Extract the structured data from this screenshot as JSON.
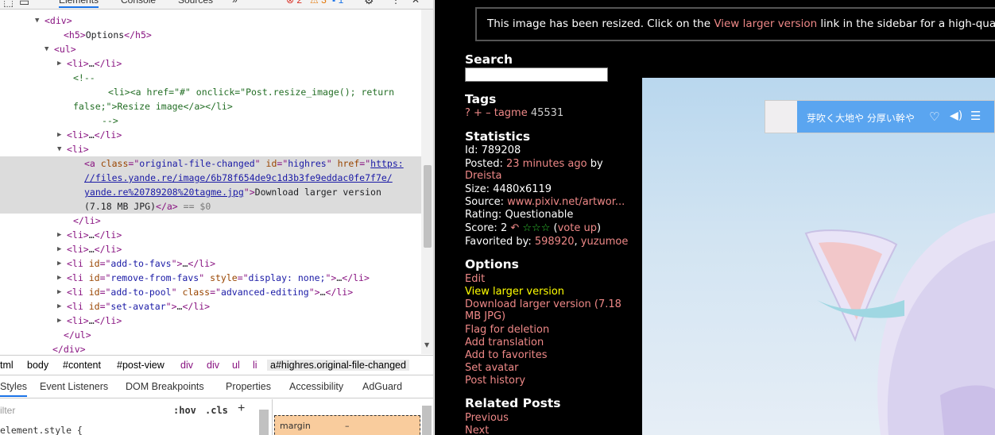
{
  "devtools": {
    "tabs": [
      "Elements",
      "Console",
      "Sources",
      "»"
    ],
    "badges": {
      "errors": "2",
      "warnings": "3",
      "info": "1"
    },
    "dom_lines": [
      {
        "indent": 56,
        "tri": "▼",
        "parts": [
          [
            "tag",
            "<div>"
          ]
        ]
      },
      {
        "indent": 80,
        "tri": "",
        "parts": [
          [
            "tag",
            "<h5>"
          ],
          [
            "txt",
            "Options"
          ],
          [
            "tag",
            "</h5>"
          ]
        ]
      },
      {
        "indent": 68,
        "tri": "▼",
        "parts": [
          [
            "tag",
            "<ul>"
          ]
        ]
      },
      {
        "indent": 84,
        "tri": "▶",
        "parts": [
          [
            "tag",
            "<li>"
          ],
          [
            "txt",
            "…"
          ],
          [
            "tag",
            "</li>"
          ]
        ]
      },
      {
        "indent": 92,
        "tri": "",
        "parts": [
          [
            "cm",
            "<!--"
          ]
        ]
      },
      {
        "indent": 136,
        "tri": "",
        "parts": [
          [
            "cm",
            "<li><a href=\"#\" onclick=\"Post.resize_image(); return"
          ]
        ]
      },
      {
        "indent": 92,
        "tri": "",
        "parts": [
          [
            "cm",
            "false;\">Resize image</a></li>"
          ]
        ]
      },
      {
        "indent": 128,
        "tri": "",
        "parts": [
          [
            "cm",
            "-->"
          ]
        ]
      },
      {
        "indent": 84,
        "tri": "▶",
        "parts": [
          [
            "tag",
            "<li>"
          ],
          [
            "txt",
            "…"
          ],
          [
            "tag",
            "</li>"
          ]
        ]
      },
      {
        "indent": 84,
        "tri": "▼",
        "parts": [
          [
            "tag",
            "<li>"
          ]
        ]
      },
      {
        "indent": 106,
        "tri": "",
        "sel": true,
        "parts": [
          [
            "tag",
            "<a "
          ],
          [
            "an",
            "class"
          ],
          [
            "tag",
            "=\""
          ],
          [
            "av",
            "original-file-changed"
          ],
          [
            "tag",
            "\" "
          ],
          [
            "an",
            "id"
          ],
          [
            "tag",
            "=\""
          ],
          [
            "av",
            "highres"
          ],
          [
            "tag",
            "\" "
          ],
          [
            "an",
            "href"
          ],
          [
            "tag",
            "=\""
          ],
          [
            "lnk",
            "https:"
          ]
        ]
      },
      {
        "indent": 106,
        "tri": "",
        "sel": true,
        "parts": [
          [
            "lnk",
            "//files.yande.re/image/6b78f654de9c1d3b3fe9eddac0fe7f7e/"
          ]
        ]
      },
      {
        "indent": 106,
        "tri": "",
        "sel": true,
        "parts": [
          [
            "lnk",
            "yande.re%20789208%20tagme.jpg"
          ],
          [
            "tag",
            "\">"
          ],
          [
            "txt",
            "Download larger version"
          ]
        ]
      },
      {
        "indent": 106,
        "tri": "",
        "sel": true,
        "parts": [
          [
            "txt",
            "(7.18 MB JPG)"
          ],
          [
            "tag",
            "</a>"
          ],
          [
            "gr",
            " == $0"
          ]
        ]
      },
      {
        "indent": 92,
        "tri": "",
        "parts": [
          [
            "tag",
            "</li>"
          ]
        ]
      },
      {
        "indent": 84,
        "tri": "▶",
        "parts": [
          [
            "tag",
            "<li>"
          ],
          [
            "txt",
            "…"
          ],
          [
            "tag",
            "</li>"
          ]
        ]
      },
      {
        "indent": 84,
        "tri": "▶",
        "parts": [
          [
            "tag",
            "<li>"
          ],
          [
            "txt",
            "…"
          ],
          [
            "tag",
            "</li>"
          ]
        ]
      },
      {
        "indent": 84,
        "tri": "▶",
        "parts": [
          [
            "tag",
            "<li "
          ],
          [
            "an",
            "id"
          ],
          [
            "tag",
            "=\""
          ],
          [
            "av",
            "add-to-favs"
          ],
          [
            "tag",
            "\">"
          ],
          [
            "txt",
            "…"
          ],
          [
            "tag",
            "</li>"
          ]
        ]
      },
      {
        "indent": 84,
        "tri": "▶",
        "parts": [
          [
            "tag",
            "<li "
          ],
          [
            "an",
            "id"
          ],
          [
            "tag",
            "=\""
          ],
          [
            "av",
            "remove-from-favs"
          ],
          [
            "tag",
            "\" "
          ],
          [
            "an",
            "style"
          ],
          [
            "tag",
            "=\""
          ],
          [
            "av",
            "display: none;"
          ],
          [
            "tag",
            "\">"
          ],
          [
            "txt",
            "…"
          ],
          [
            "tag",
            "</li>"
          ]
        ]
      },
      {
        "indent": 84,
        "tri": "▶",
        "parts": [
          [
            "tag",
            "<li "
          ],
          [
            "an",
            "id"
          ],
          [
            "tag",
            "=\""
          ],
          [
            "av",
            "add-to-pool"
          ],
          [
            "tag",
            "\" "
          ],
          [
            "an",
            "class"
          ],
          [
            "tag",
            "=\""
          ],
          [
            "av",
            "advanced-editing"
          ],
          [
            "tag",
            "\">"
          ],
          [
            "txt",
            "…"
          ],
          [
            "tag",
            "</li>"
          ]
        ]
      },
      {
        "indent": 84,
        "tri": "▶",
        "parts": [
          [
            "tag",
            "<li "
          ],
          [
            "an",
            "id"
          ],
          [
            "tag",
            "=\""
          ],
          [
            "av",
            "set-avatar"
          ],
          [
            "tag",
            "\">"
          ],
          [
            "txt",
            "…"
          ],
          [
            "tag",
            "</li>"
          ]
        ]
      },
      {
        "indent": 84,
        "tri": "▶",
        "parts": [
          [
            "tag",
            "<li>"
          ],
          [
            "txt",
            "…"
          ],
          [
            "tag",
            "</li>"
          ]
        ]
      },
      {
        "indent": 80,
        "tri": "",
        "parts": [
          [
            "tag",
            "</ul>"
          ]
        ]
      },
      {
        "indent": 66,
        "tri": "",
        "parts": [
          [
            "tag",
            "</div>"
          ]
        ]
      }
    ],
    "breadcrumbs": [
      "tml",
      "body",
      "#content",
      "#post-view",
      "div",
      "div",
      "ul",
      "li",
      "a#highres.original-file-changed"
    ],
    "sub_tabs": [
      "Styles",
      "Event Listeners",
      "DOM Breakpoints",
      "Properties",
      "Accessibility",
      "AdGuard"
    ],
    "filter_placeholder": "ilter",
    "hov_label": ":hov",
    "cls_label": ".cls",
    "plus_label": "+",
    "element_style": "element.style {",
    "box_margin_label": "margin",
    "box_margin_value": "–"
  },
  "page": {
    "notice_prefix": "This image has been resized. Click on the ",
    "notice_link": "View larger version",
    "notice_suffix": " link in the sidebar for a high-quality v",
    "search_heading": "Search",
    "tags_heading": "Tags",
    "tag_q": "?",
    "tag_plus": "+",
    "tag_minus": "–",
    "tag_name": "tagme",
    "tag_count": "45531",
    "stats_heading": "Statistics",
    "id_label": "Id:",
    "id_value": "789208",
    "posted_label": "Posted:",
    "posted_value": "23 minutes ago",
    "posted_by": " by",
    "poster": "Dreista",
    "size_label": "Size:",
    "size_value": "4480x6119",
    "source_label": "Source:",
    "source_value": "www.pixiv.net/artwor...",
    "rating_label": "Rating:",
    "rating_value": "Questionable",
    "score_label": "Score:",
    "score_value": "2",
    "score_stars": "☆☆☆",
    "vote_up": "vote up",
    "fav_label": "Favorited by:",
    "fav_user1": "598920",
    "fav_user2": "yuzumoe",
    "options_heading": "Options",
    "opt_edit": "Edit",
    "opt_view_larger": "View larger version",
    "opt_download_1": "Download larger version (7.18",
    "opt_download_2": "MB JPG)",
    "opt_flag": "Flag for deletion",
    "opt_translation": "Add translation",
    "opt_favorites": "Add to favorites",
    "opt_avatar": "Set avatar",
    "opt_history": "Post history",
    "related_heading": "Related Posts",
    "rel_previous": "Previous",
    "rel_next": "Next",
    "ad_text": "芽吹く大地や 分厚い幹や",
    "colors": {
      "link": "#ee8887",
      "visited": "#ffff00",
      "background": "#000000"
    }
  }
}
